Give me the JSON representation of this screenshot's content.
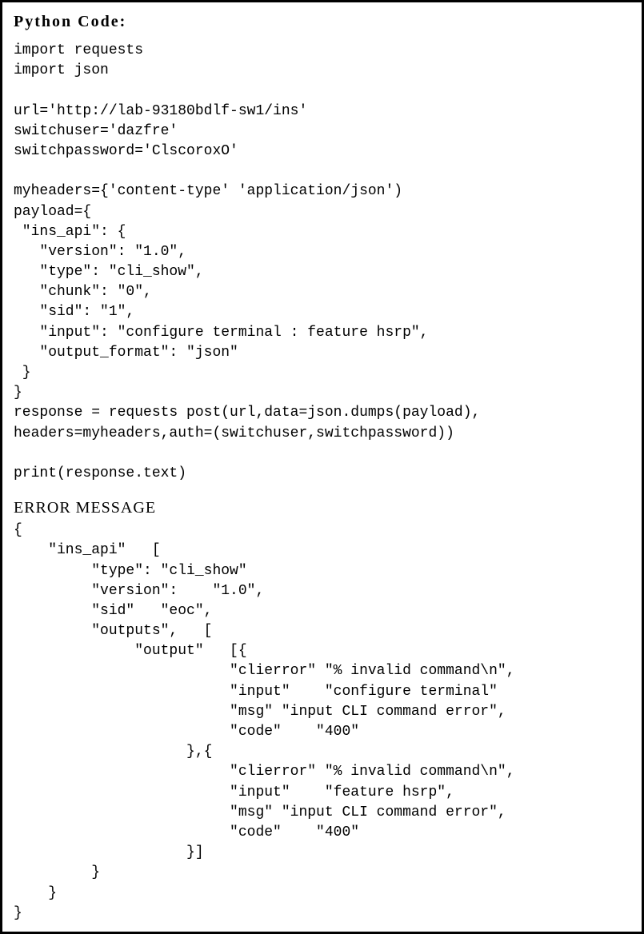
{
  "title": "Python  Code:",
  "code": "import requests\nimport json\n\nurl='http://lab-93180bdlf-sw1/ins'\nswitchuser='dazfre'\nswitchpassword='ClscoroxO'\n\nmyheaders={'content-type' 'application/json')\npayload={\n \"ins_api\": {\n   \"version\": \"1.0\",\n   \"type\": \"cli_show\",\n   \"chunk\": \"0\",\n   \"sid\": \"1\",\n   \"input\": \"configure terminal : feature hsrp\",\n   \"output_format\": \"json\"\n }\n}\nresponse = requests post(url,data=json.dumps(payload),\nheaders=myheaders,auth=(switchuser,switchpassword))\n\nprint(response.text)",
  "error_title": "ERROR MESSAGE",
  "error_body": "{\n    \"ins_api\"   [\n         \"type\": \"cli_show\"\n         \"version\":    \"1.0\",\n         \"sid\"   \"eoc\",\n         \"outputs\",   [\n              \"output\"   [{\n                         \"clierror\" \"% invalid command\\n\",\n                         \"input\"    \"configure terminal\"\n                         \"msg\" \"input CLI command error\",\n                         \"code\"    \"400\"\n                    },{\n                         \"clierror\" \"% invalid command\\n\",\n                         \"input\"    \"feature hsrp\",\n                         \"msg\" \"input CLI command error\",\n                         \"code\"    \"400\"\n                    }]\n         }\n    }\n}"
}
